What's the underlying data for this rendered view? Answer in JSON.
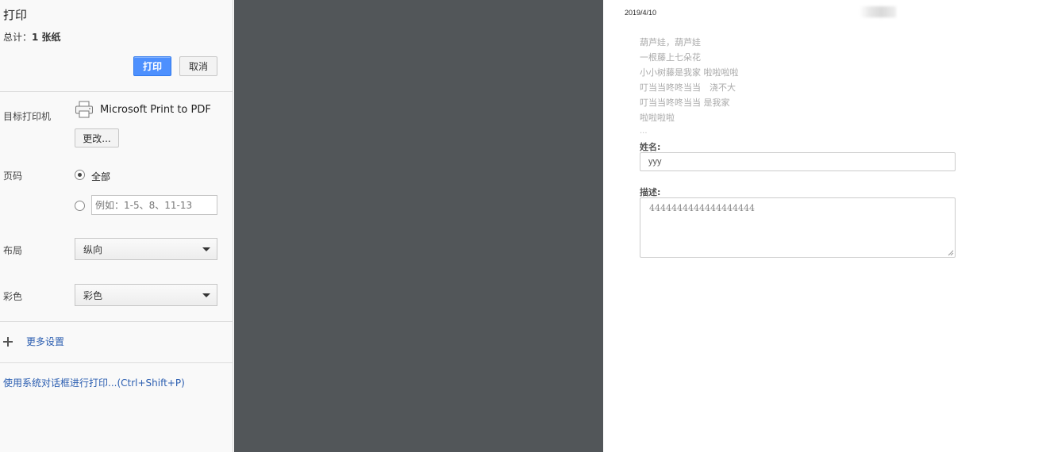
{
  "panel": {
    "title": "打印",
    "summary_prefix": "总计：",
    "summary_value": "1 张纸",
    "print_label": "打印",
    "cancel_label": "取消",
    "destination": {
      "label": "目标打印机",
      "printer_name": "Microsoft Print to PDF",
      "change_label": "更改..."
    },
    "pages": {
      "label": "页码",
      "all_label": "全部",
      "custom_placeholder": "例如：1-5、8、11-13"
    },
    "layout": {
      "label": "布局",
      "value": "纵向"
    },
    "color": {
      "label": "彩色",
      "value": "彩色"
    },
    "more_settings": "更多设置",
    "system_dialog": "使用系统对话框进行打印...(Ctrl+Shift+P)"
  },
  "preview": {
    "date": "2019/4/10",
    "lyrics": [
      "葫芦娃，葫芦娃",
      "一根藤上七朵花",
      "小小树藤是我家 啦啦啦啦",
      "叮当当咚咚当当　浇不大",
      "叮当当咚咚当当 是我家",
      "啦啦啦啦"
    ],
    "ellipsis": "...",
    "name_label": "姓名:",
    "name_value": "yyy",
    "desc_label": "描述:",
    "desc_value": "4444444444444444444"
  },
  "colors": {
    "print_button": "#4d90fe",
    "preview_background": "#525659",
    "link": "#2a5db0"
  }
}
